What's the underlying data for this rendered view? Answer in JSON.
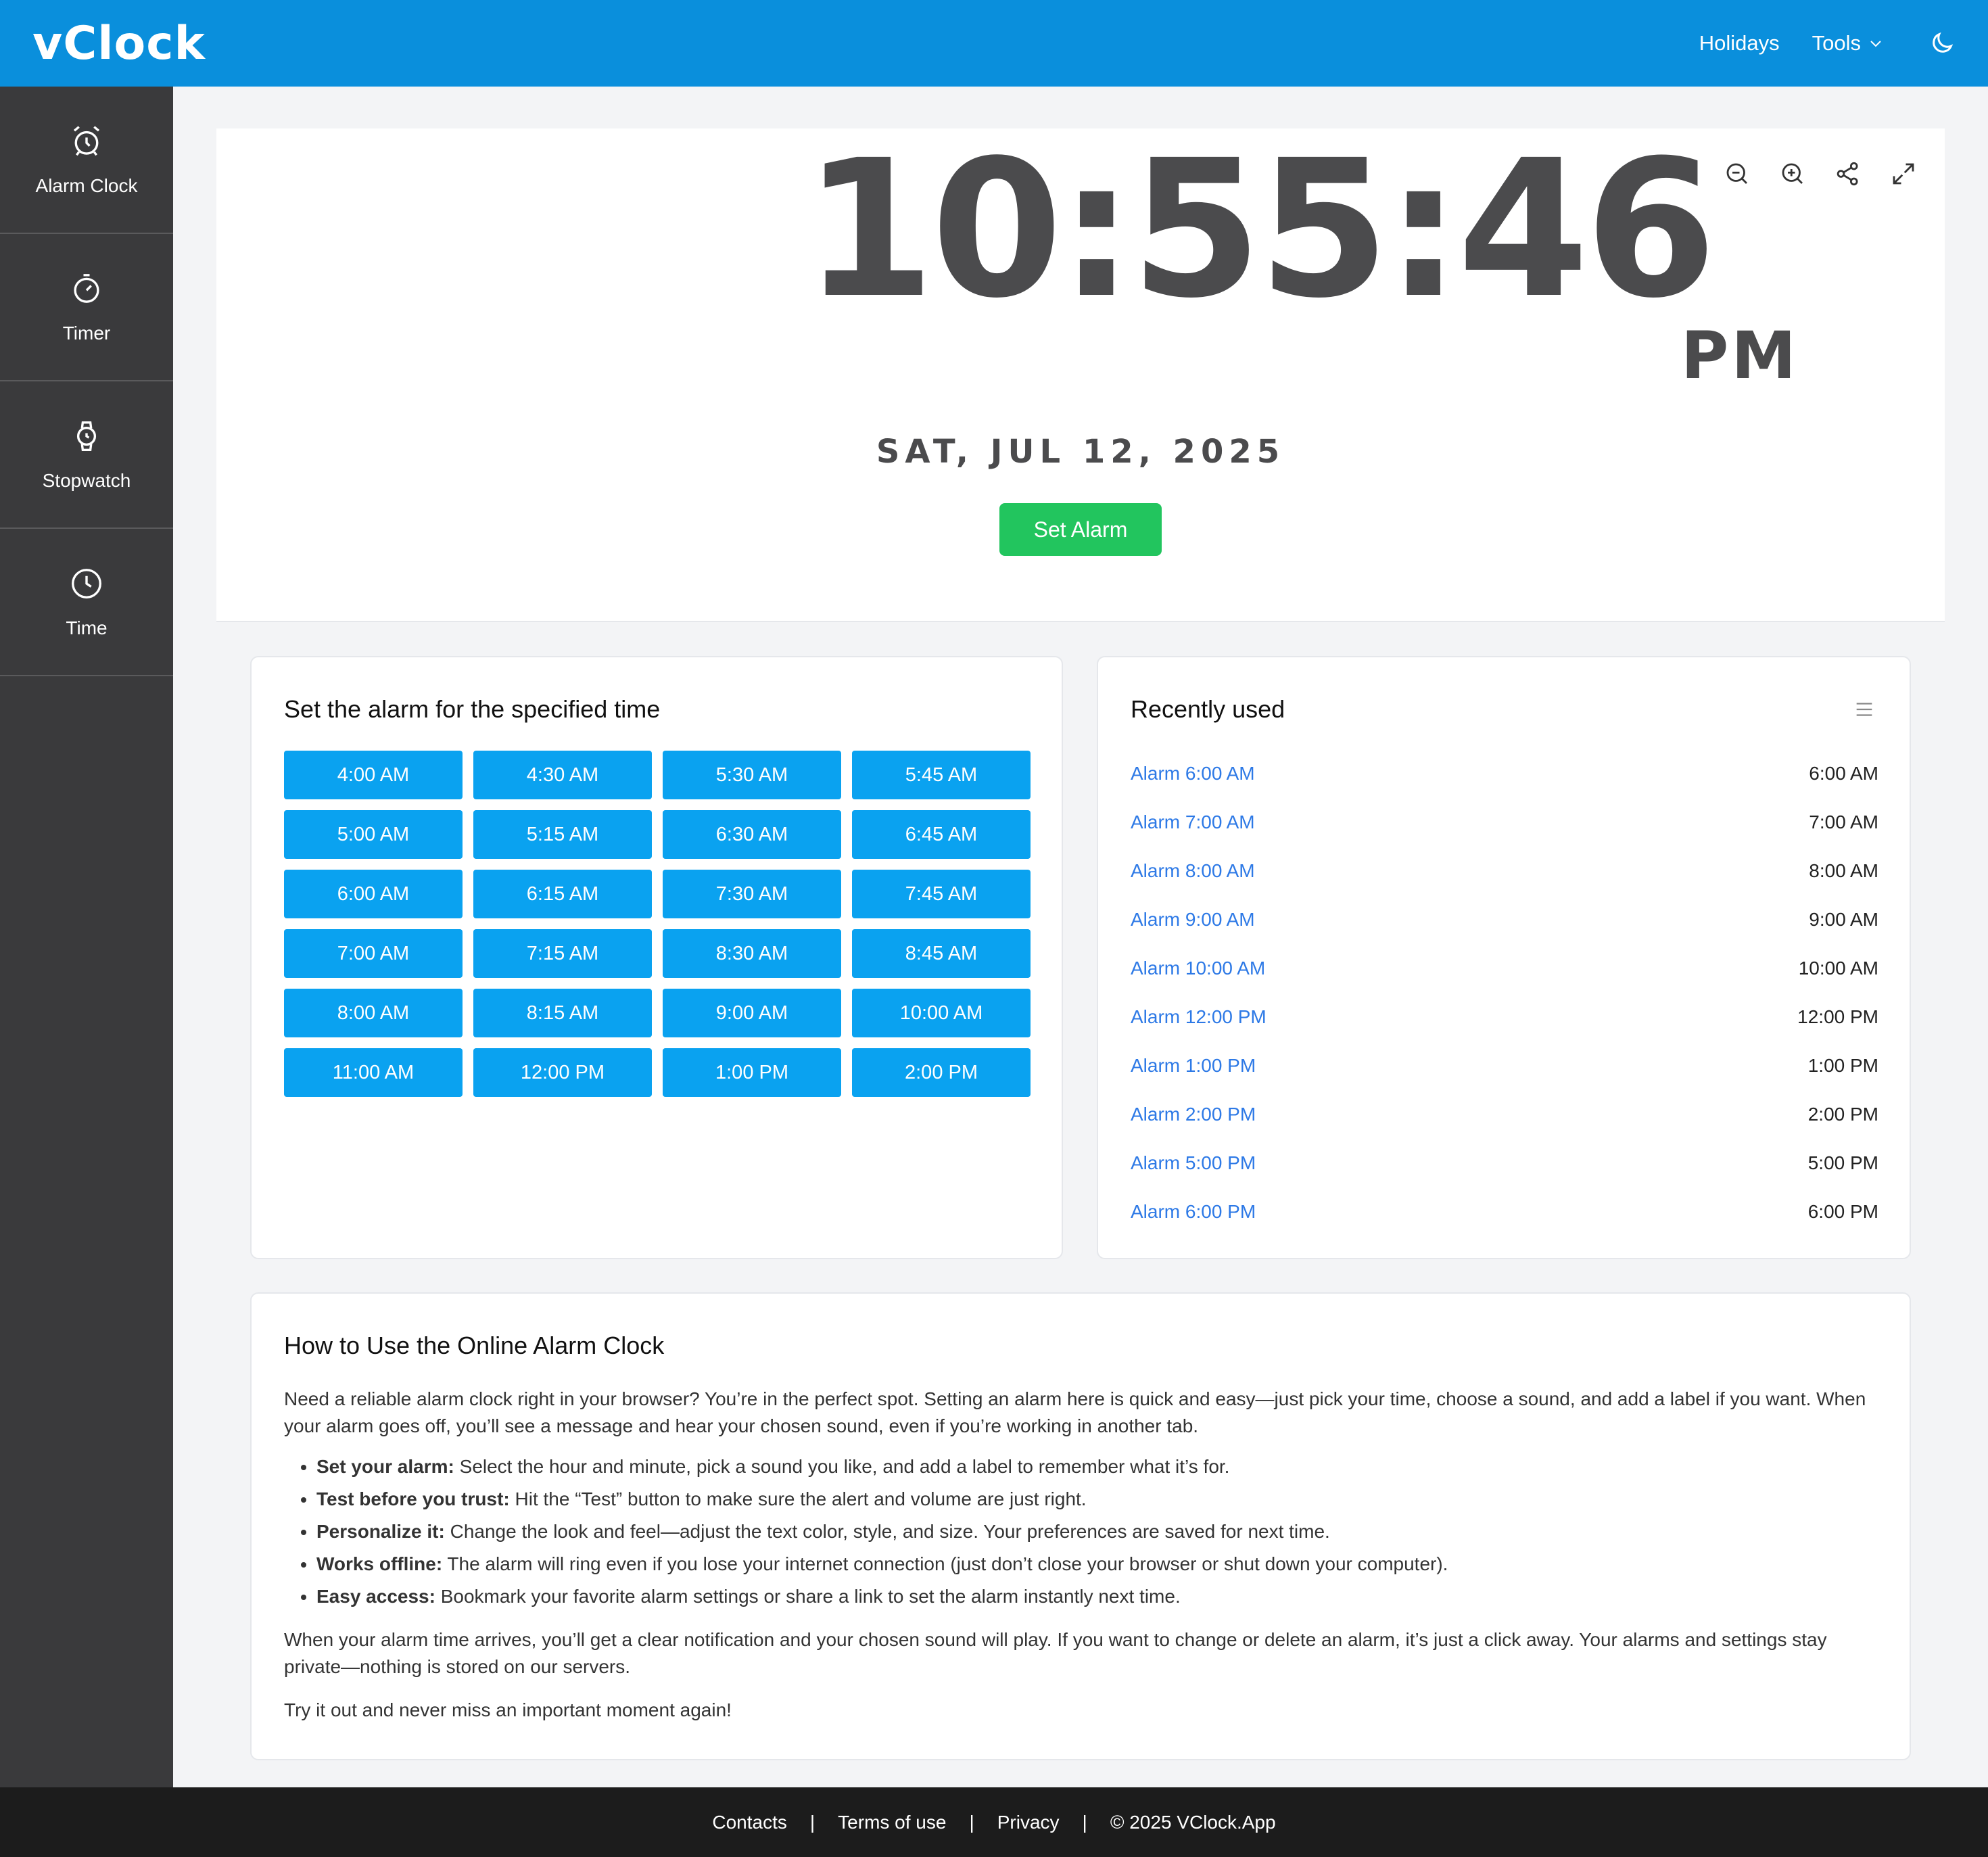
{
  "header": {
    "logo": "vClock",
    "nav": {
      "holidays": "Holidays",
      "tools": "Tools"
    }
  },
  "sidebar": {
    "items": [
      {
        "label": "Alarm Clock",
        "icon": "alarm-clock-icon"
      },
      {
        "label": "Timer",
        "icon": "timer-icon"
      },
      {
        "label": "Stopwatch",
        "icon": "stopwatch-icon"
      },
      {
        "label": "Time",
        "icon": "clock-icon"
      }
    ]
  },
  "clock": {
    "time": "10:55:46",
    "ampm": "PM",
    "date": "SAT, JUL 12, 2025",
    "set_alarm_label": "Set Alarm",
    "tools": [
      "zoom-out-icon",
      "zoom-in-icon",
      "share-icon",
      "fullscreen-icon"
    ]
  },
  "presets": {
    "title": "Set the alarm for the specified time",
    "times": [
      "4:00 AM",
      "4:30 AM",
      "5:30 AM",
      "5:45 AM",
      "5:00 AM",
      "5:15 AM",
      "6:30 AM",
      "6:45 AM",
      "6:00 AM",
      "6:15 AM",
      "7:30 AM",
      "7:45 AM",
      "7:00 AM",
      "7:15 AM",
      "8:30 AM",
      "8:45 AM",
      "8:00 AM",
      "8:15 AM",
      "9:00 AM",
      "10:00 AM",
      "11:00 AM",
      "12:00 PM",
      "1:00 PM",
      "2:00 PM"
    ]
  },
  "recent": {
    "title": "Recently used",
    "items": [
      {
        "label": "Alarm 6:00 AM",
        "time": "6:00 AM"
      },
      {
        "label": "Alarm 7:00 AM",
        "time": "7:00 AM"
      },
      {
        "label": "Alarm 8:00 AM",
        "time": "8:00 AM"
      },
      {
        "label": "Alarm 9:00 AM",
        "time": "9:00 AM"
      },
      {
        "label": "Alarm 10:00 AM",
        "time": "10:00 AM"
      },
      {
        "label": "Alarm 12:00 PM",
        "time": "12:00 PM"
      },
      {
        "label": "Alarm 1:00 PM",
        "time": "1:00 PM"
      },
      {
        "label": "Alarm 2:00 PM",
        "time": "2:00 PM"
      },
      {
        "label": "Alarm 5:00 PM",
        "time": "5:00 PM"
      },
      {
        "label": "Alarm 6:00 PM",
        "time": "6:00 PM"
      }
    ]
  },
  "howto": {
    "title": "How to Use the Online Alarm Clock",
    "intro": "Need a reliable alarm clock right in your browser? You’re in the perfect spot. Setting an alarm here is quick and easy—just pick your time, choose a sound, and add a label if you want. When your alarm goes off, you’ll see a message and hear your chosen sound, even if you’re working in another tab.",
    "bullets": [
      {
        "bold": "Set your alarm:",
        "text": " Select the hour and minute, pick a sound you like, and add a label to remember what it’s for."
      },
      {
        "bold": "Test before you trust:",
        "text": " Hit the “Test” button to make sure the alert and volume are just right."
      },
      {
        "bold": "Personalize it:",
        "text": " Change the look and feel—adjust the text color, style, and size. Your preferences are saved for next time."
      },
      {
        "bold": "Works offline:",
        "text": " The alarm will ring even if you lose your internet connection (just don’t close your browser or shut down your computer)."
      },
      {
        "bold": "Easy access:",
        "text": " Bookmark your favorite alarm settings or share a link to set the alarm instantly next time."
      }
    ],
    "outro": "When your alarm time arrives, you’ll get a clear notification and your chosen sound will play. If you want to change or delete an alarm, it’s just a click away. Your alarms and settings stay private—nothing is stored on our servers.",
    "closing": "Try it out and never miss an important moment again!"
  },
  "footer": {
    "contacts": "Contacts",
    "sep": "|",
    "terms": "Terms of use",
    "privacy": "Privacy",
    "copyright": "© 2025 VClock.App"
  }
}
